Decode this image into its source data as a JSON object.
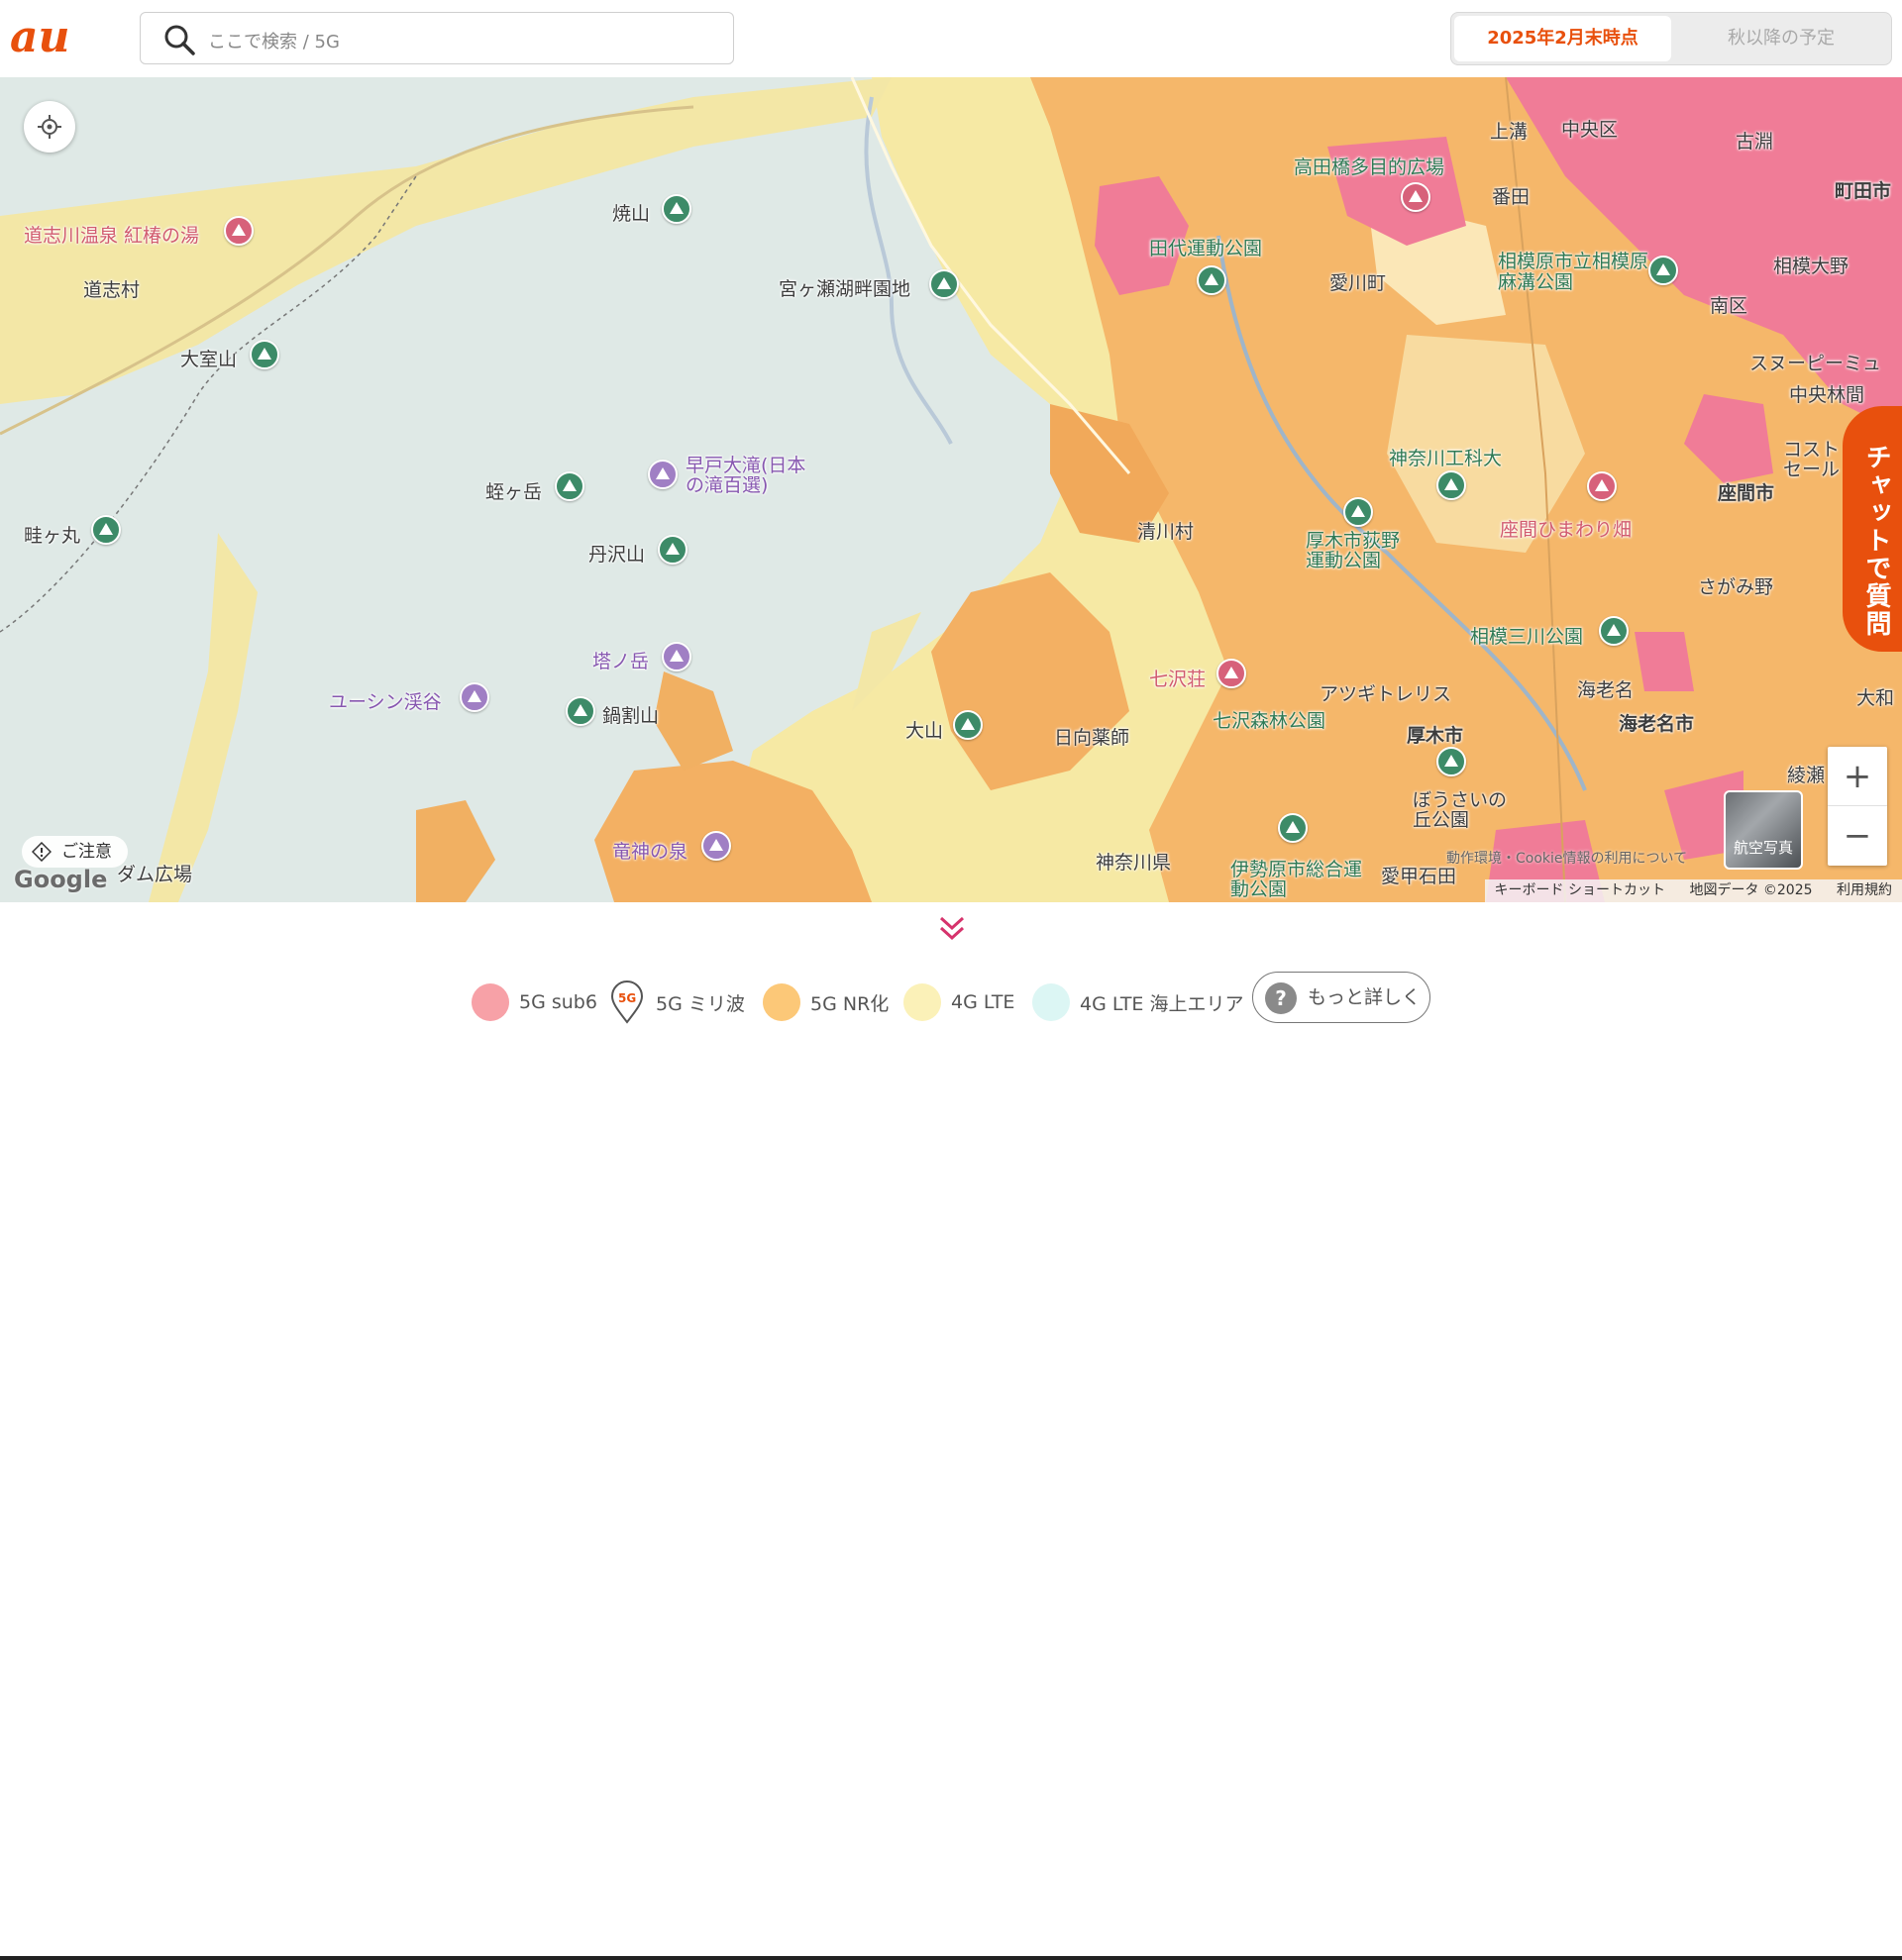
{
  "header": {
    "logo_text": "au",
    "search_placeholder": "ここで検索 / 5G",
    "segment": {
      "active": "2025年2月末時点",
      "inactive": "秋以降の予定"
    }
  },
  "map": {
    "labels": {
      "michishi_onsen": "道志川温泉 紅椿の湯",
      "michishi_mura": "道志村",
      "omuro": "大室山",
      "yakeyama": "焼山",
      "miyagase": "宮ヶ瀬湖畔園地",
      "hayato": "早戸大滝(日本の滝百選)",
      "hiru": "蛭ヶ岳",
      "tanzawa": "丹沢山",
      "azegamaru": "畦ヶ丸",
      "tonodake": "塔ノ岳",
      "yushin": "ユーシン渓谷",
      "nabewari": "鍋割山",
      "oyama": "大山",
      "ryujin": "竜神の泉",
      "kiyokawa": "清川村",
      "nanasawa_so": "七沢荘",
      "nanasawa_park": "七沢森林公園",
      "hinata": "日向薬師",
      "atsugi_city": "厚木市",
      "ebina_city": "海老名市",
      "ebina": "海老名",
      "aikawa": "愛川町",
      "tashiro": "田代運動公園",
      "takatabashi": "高田橋多目的広場",
      "kamimizo": "上溝",
      "chuo_ku": "中央区",
      "banda": "番田",
      "sagamihara_asamizo": "相模原市立相模原麻溝公園",
      "furubuchi": "古淵",
      "machida": "町田市",
      "sagami_ono": "相模大野",
      "minami_ku": "南区",
      "kanagawa_koka": "神奈川工科大",
      "zama_himawari": "座間ひまわり畑",
      "zama": "座間市",
      "ogino": "厚木市荻野運動公園",
      "sagami_mitsukawa": "相模三川公園",
      "atsugi_torres": "アツギトレリス",
      "hosai": "ぼうさいの丘公園",
      "isehara": "伊勢原市総合運動公園",
      "aiko_ishida": "愛甲石田",
      "kanagawa_pref": "神奈川県",
      "sagamino": "さがみ野",
      "chuo_rinkan": "中央林間",
      "snoopy": "スヌーピーミュ",
      "cost": "コスト セール",
      "ayase": "綾瀬",
      "yamato": "大和",
      "dam": "ダム広場"
    },
    "caution": "ご注意",
    "google": "Google",
    "cookie_notice": "動作環境・Cookie情報の利用について",
    "attribution": [
      "キーボード ショートカット",
      "地図データ ©2025",
      "利用規約"
    ],
    "aerial_label": "航空写真",
    "zoom_in": "+",
    "zoom_out": "−",
    "chat_label": "チャットで質問"
  },
  "legend": {
    "items": [
      {
        "label": "5G sub6",
        "color": "#f7a1a7"
      },
      {
        "label": "5G ミリ波",
        "color": "#e8500d"
      },
      {
        "label": "5G NR化",
        "color": "#fcc878"
      },
      {
        "label": "4G LTE",
        "color": "#fbf1b8"
      },
      {
        "label": "4G LTE 海上エリア",
        "color": "#dcf6f4"
      }
    ],
    "more_label": "もっと詳しく"
  },
  "colors": {
    "accent": "#e8500d",
    "sub6": "#f07c97",
    "nr": "#f5b76a",
    "lte": "#f6e9a4",
    "terrain": "#dfe9e6"
  }
}
